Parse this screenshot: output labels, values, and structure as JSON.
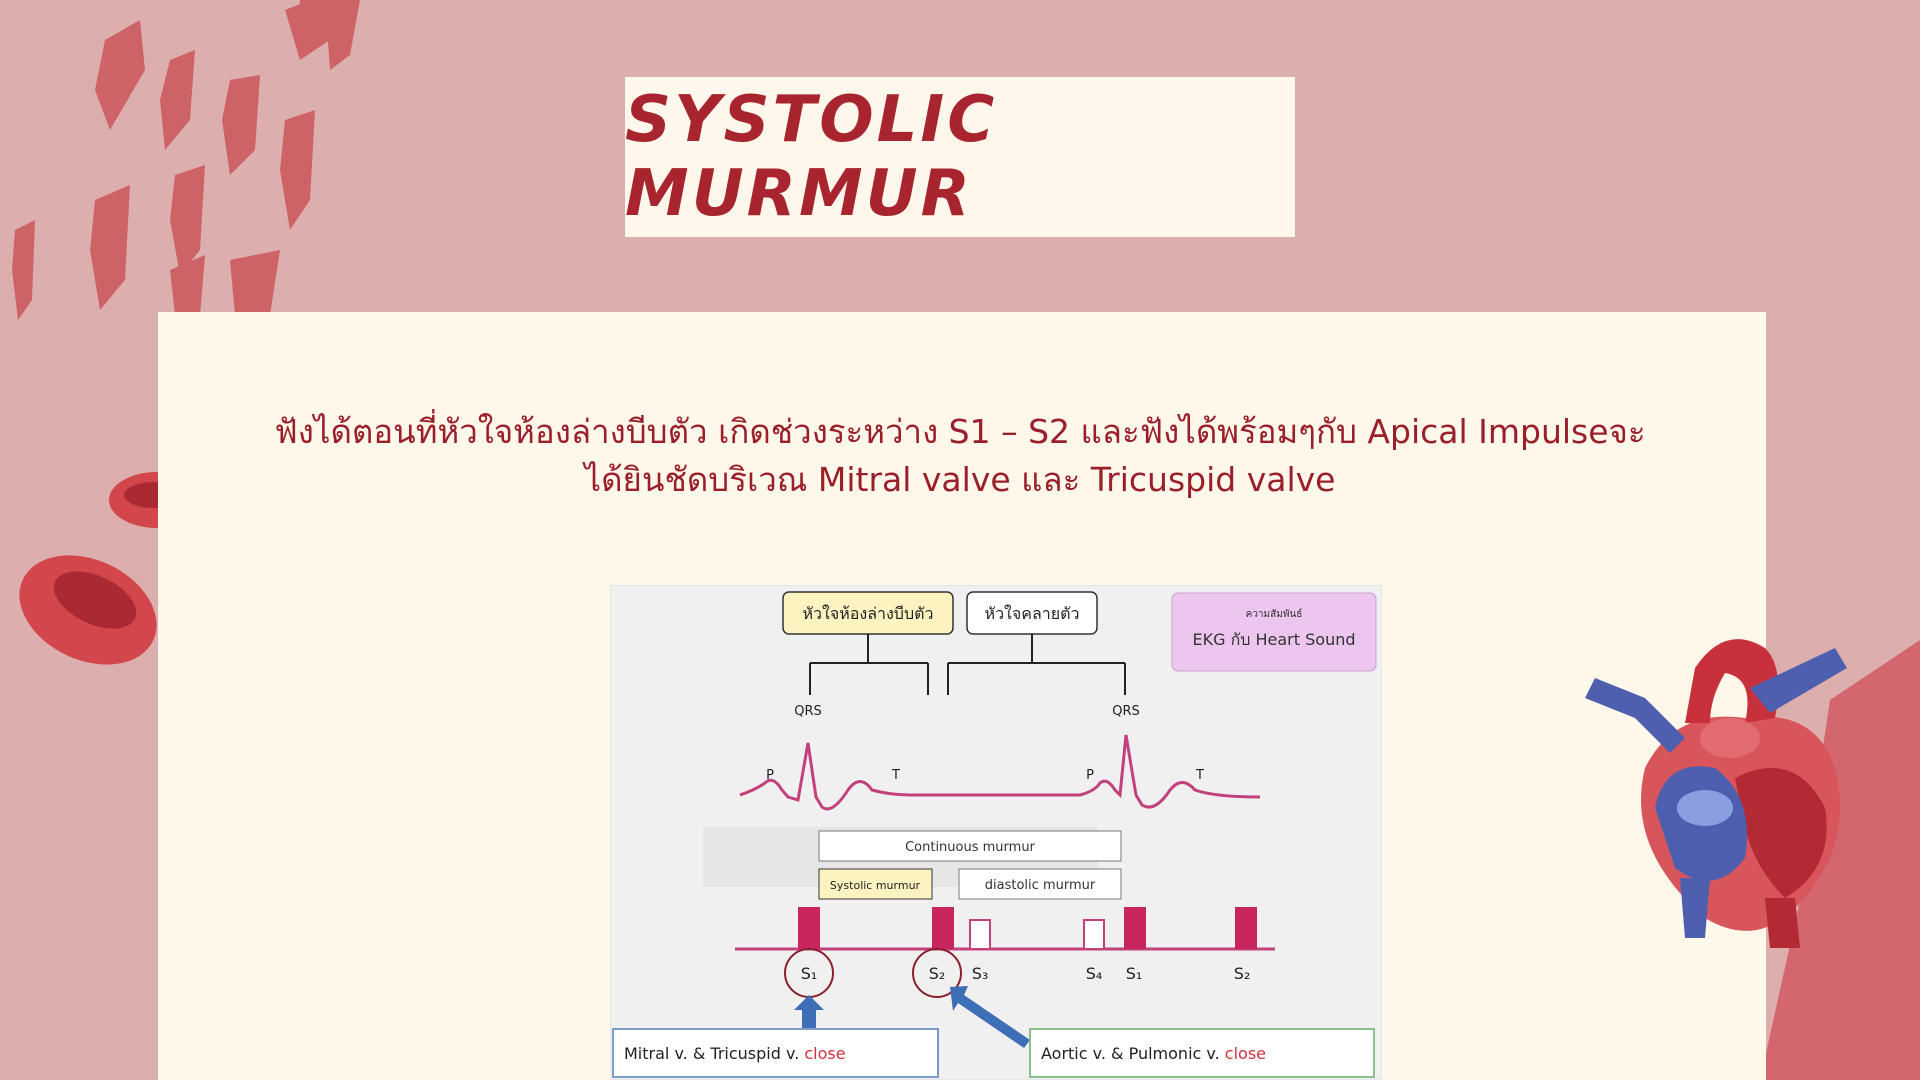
{
  "slide": {
    "title": "SYSTOLIC MURMUR",
    "description_line1": "ฟังได้ตอนที่หัวใจห้องล่างบีบตัว เกิดช่วงระหว่าง S1 – S2 และฟังได้พร้อมๆกับ Apical Impulseจะ",
    "description_line2": "ได้ยินชัดบริเวณ Mitral valve และ Tricuspid valve"
  },
  "diagram": {
    "label_contract": "หัวใจห้องล่างบีบตัว",
    "label_relax": "หัวใจคลายตัว",
    "legend_small": "ความสัมพันธ์",
    "legend_main": "EKG กับ Heart Sound",
    "qrs_left": "QRS",
    "qrs_right": "QRS",
    "wave_p1": "P",
    "wave_t1": "T",
    "wave_p2": "P",
    "wave_t2": "T",
    "continuous_murmur": "Continuous murmur",
    "systolic_murmur": "Systolic murmur",
    "diastolic_murmur": "diastolic murmur",
    "s1": "S₁",
    "s2": "S₂",
    "s3": "S₃",
    "s4": "S₄",
    "s1b": "S₁",
    "s2b": "S₂",
    "mitral_text": "Mitral v. & Tricuspid v.",
    "mitral_close": "close",
    "aortic_text": "Aortic v. & Pulmonic v.",
    "aortic_close": "close"
  },
  "colors": {
    "background": "#ddaeae",
    "accent": "#a8242e",
    "ekg_line": "#c2417c",
    "sound_bar": "#c8245e",
    "arrow": "#3e6fb6"
  }
}
